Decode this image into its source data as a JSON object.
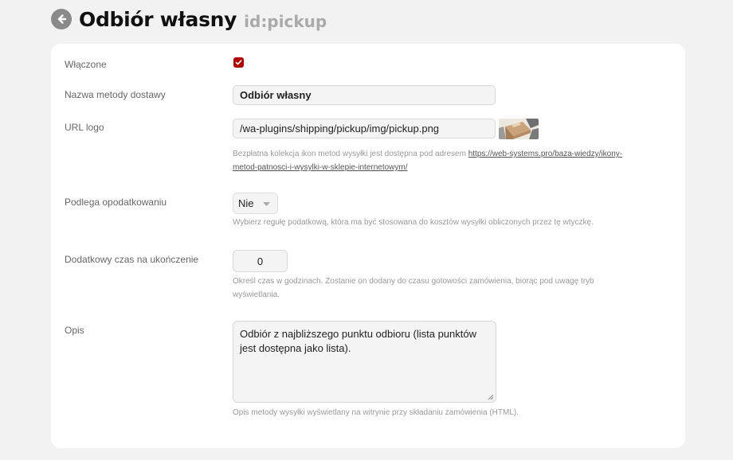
{
  "header": {
    "title": "Odbiór własny",
    "id_label": "id:pickup"
  },
  "form": {
    "enabled": {
      "label": "Włączone",
      "checked": true
    },
    "name": {
      "label": "Nazwa metody dostawy",
      "value": "Odbiór własny"
    },
    "logo": {
      "label": "URL logo",
      "value": "/wa-plugins/shipping/pickup/img/pickup.png",
      "hint_text": "Bezpłatna kolekcja ikon metod wysyłki jest dostępna pod adresem ",
      "hint_link_line1": "https://web-systems.pro/baza-wiedzy/ikony-",
      "hint_link_line2": "metod-patnosci-i-wysylki-w-sklepie-internetowym/"
    },
    "tax": {
      "label": "Podlega opodatkowaniu",
      "selected": "Nie",
      "hint": "Wybierz regułę podatkową, która ma być stosowana do kosztów wysyłki obliczonych przez tę wtyczkę."
    },
    "extra_time": {
      "label": "Dodatkowy czas na ukończenie",
      "value": "0",
      "hint_line1": "Określ czas w godzinach. Zostanie on dodany do czasu gotowości zamówienia, biorąc pod uwagę tryb",
      "hint_line2": "wyświetlania."
    },
    "description": {
      "label": "Opis",
      "value_line1": "Odbiór z najbliższego punktu odbioru (lista punktów",
      "value_line2": "jest dostępna jako lista).",
      "hint": "Opis metody wysyłki wyświetlany na witrynie przy składaniu zamówienia (HTML)."
    }
  },
  "colors": {
    "accent": "#b30000",
    "background": "#f2f2f2",
    "card": "#ffffff"
  },
  "icons": {
    "back": "arrow-left-circle-icon",
    "check": "checkmark-icon",
    "caret": "chevron-down-icon",
    "resize": "resize-handle-icon"
  }
}
